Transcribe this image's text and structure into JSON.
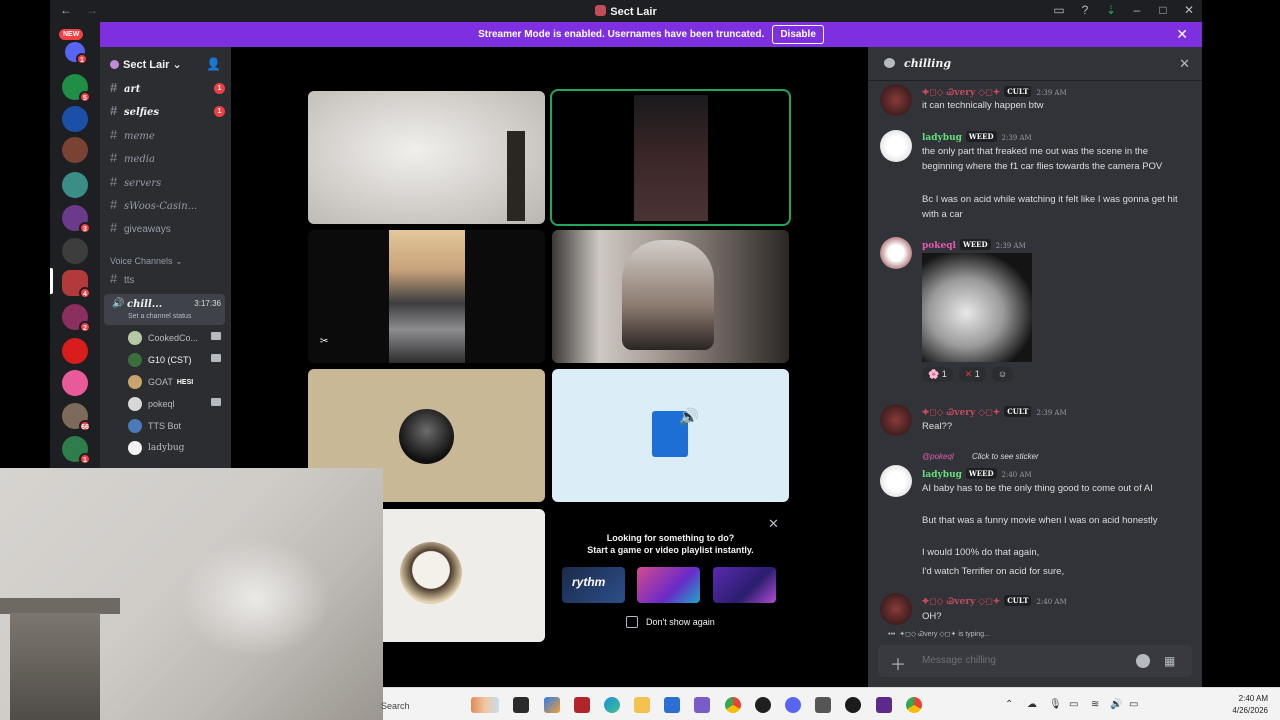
{
  "window": {
    "title": "Sect Lair",
    "controls": [
      "minimize",
      "maximize",
      "close"
    ]
  },
  "banner": {
    "text": "Streamer Mode is enabled. Usernames have been truncated.",
    "button": "Disable"
  },
  "rail": {
    "new_label": "NEW",
    "badges": [
      "1",
      "5",
      "3",
      "4",
      "2",
      "3",
      "66",
      "1"
    ]
  },
  "server": {
    "name": "Sect Lair"
  },
  "channels": [
    {
      "name": "art",
      "unread": true,
      "badge": "1"
    },
    {
      "name": "selfies",
      "unread": true,
      "badge": "1"
    },
    {
      "name": "meme",
      "unread": false
    },
    {
      "name": "media",
      "unread": false
    },
    {
      "name": "servers",
      "unread": false
    },
    {
      "name": "sWoos-Casin...",
      "unread": false
    },
    {
      "name": "giveaways",
      "unread": false
    }
  ],
  "voice": {
    "category": "Voice Channels",
    "tts_channel": "tts",
    "active_channel": "chill...",
    "timer": "3:17:36",
    "status": "Set a channel status",
    "users": [
      {
        "name": "CookedCo...",
        "color": "#b7c9a4"
      },
      {
        "name": "G10 (CST)",
        "color": "#3a6e3c"
      },
      {
        "name": "GOAT",
        "color": "#c9a46c",
        "tag": "HESI"
      },
      {
        "name": "pokeql",
        "color": "#d8d8d8"
      },
      {
        "name": "TTS Bot",
        "color": "#4a7ab8"
      },
      {
        "name": "ladybug",
        "color": "#f2f2f2"
      }
    ]
  },
  "activity": {
    "title": "Looking for something to do?",
    "subtitle": "Start a game or video playlist instantly.",
    "promos": [
      "rythm",
      "game-2",
      "game-3"
    ],
    "dont_show": "Don't show again"
  },
  "chat": {
    "channel": "chilling",
    "messages": [
      {
        "user": "✦◻◇ Ꮚvery ◇◻✦",
        "tag": "CULT",
        "time": "2:39 AM",
        "text": "it can technically happen btw"
      },
      {
        "user": "ladybug",
        "tag": "WEED",
        "time": "2:39 AM",
        "lines": [
          "the only part that freaked me out was the scene in the beginning where the f1 car flies towards the camera POV",
          "Bc I was on acid while watching it felt like I was gonna get hit with a car"
        ]
      },
      {
        "user": "pokeql",
        "tag": "WEED",
        "time": "2:39 AM"
      },
      {
        "user": "✦◻◇ Ꮚvery ◇◻✦",
        "tag": "CULT",
        "time": "2:39 AM",
        "text": "Real??"
      },
      {
        "user": "ladybug",
        "tag": "WEED",
        "time": "2:40 AM",
        "reply": "@pokeql",
        "reply_text": "Click to see sticker",
        "lines": [
          "AI baby has to be the only thing good to come out of AI",
          "But that was a funny movie when I was on acid honestly",
          "I would 100% do that again,",
          "I'd watch Terrifier on acid for sure,"
        ]
      },
      {
        "user": "✦◻◇ Ꮚvery ◇◻✦",
        "tag": "CULT",
        "time": "2:40 AM",
        "text": "OH?"
      }
    ],
    "reactions": [
      "1",
      "1"
    ],
    "typing": "✦◻◇ Ꮚvery ◇◻✦ is typing...",
    "placeholder": "Message chilling"
  },
  "taskbar": {
    "search": "Search",
    "time": "2:40 AM",
    "date": "4/26/2026"
  }
}
